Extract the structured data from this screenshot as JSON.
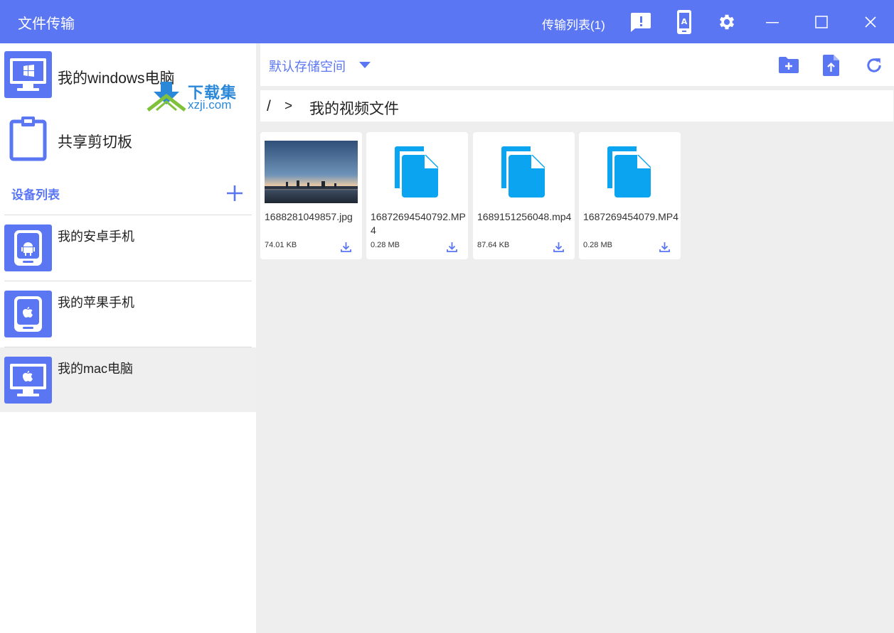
{
  "window": {
    "title": "文件传输",
    "transfer_list": "传输列表(1)",
    "icons": [
      "feedback-icon",
      "mobile-icon",
      "gear-icon",
      "minimize-icon",
      "maximize-icon",
      "close-icon"
    ]
  },
  "sidebar": {
    "top_items": [
      {
        "label": "我的windows电脑",
        "icon": "windows-desktop-icon"
      },
      {
        "label": "共享剪切板",
        "icon": "clipboard-icon"
      }
    ],
    "section_title": "设备列表",
    "devices": [
      {
        "label": "我的安卓手机",
        "icon": "android-phone-icon"
      },
      {
        "label": "我的苹果手机",
        "icon": "apple-phone-icon"
      },
      {
        "label": "我的mac电脑",
        "icon": "mac-desktop-icon",
        "active": true
      }
    ]
  },
  "watermark": {
    "line1": "下载集",
    "line2": "xzji.com"
  },
  "toolbar": {
    "storage": "默认存储空间",
    "icons": [
      "new-folder-icon",
      "upload-file-icon",
      "refresh-icon"
    ]
  },
  "breadcrumb": {
    "root": "/",
    "separator": ">",
    "folder": "我的视频文件"
  },
  "files": [
    {
      "name": "1688281049857.jpg",
      "size": "74.01  KB",
      "type": "image"
    },
    {
      "name": "16872694540792.MP4",
      "size": "0.28  MB",
      "type": "file"
    },
    {
      "name": "1689151256048.mp4",
      "size": "87.64  KB",
      "type": "file"
    },
    {
      "name": "1687269454079.MP4",
      "size": "0.28  MB",
      "type": "file"
    }
  ],
  "colors": {
    "accent": "#5a76f3",
    "file_icon": "#0aa4f0",
    "background": "#efeeef"
  }
}
